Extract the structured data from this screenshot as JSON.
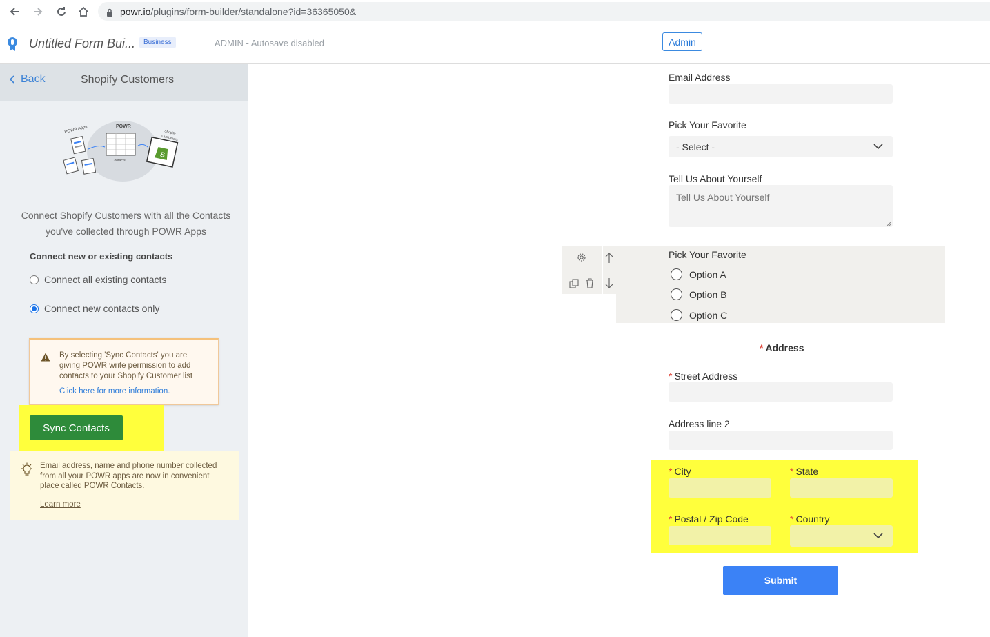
{
  "browser": {
    "url_host": "powr.io",
    "url_path": "/plugins/form-builder/standalone?id=36365050&"
  },
  "header": {
    "app_title": "Untitled Form Bui...",
    "plan_badge": "Business",
    "autosave_status": "ADMIN - Autosave disabled",
    "admin_button": "Admin"
  },
  "left_panel": {
    "back_label": "Back",
    "title": "Shopify Customers",
    "illustration": {
      "powr_apps": "POWR Apps",
      "powr": "POWR",
      "contacts": "Contacts",
      "shopify": "Shopify",
      "customers": "Customers"
    },
    "description_line1": "Connect Shopify Customers with all the Contacts",
    "description_line2": "you've collected through POWR Apps",
    "section_label": "Connect new or existing contacts",
    "options": [
      {
        "label": "Connect all existing contacts",
        "selected": false
      },
      {
        "label": "Connect new contacts only",
        "selected": true
      }
    ],
    "warning_text": "By selecting 'Sync Contacts' you are giving POWR write permission to add contacts to your Shopify Customer list",
    "warning_link": "Click here for more information.",
    "sync_button": "Sync Contacts",
    "info_text": "Email address, name and phone number collected from all your POWR apps are now in convenient place called POWR Contacts.",
    "info_link": "Learn more"
  },
  "form": {
    "email_label": "Email Address",
    "pick_label": "Pick Your Favorite",
    "pick_select_value": "- Select -",
    "about_label": "Tell Us About Yourself",
    "about_placeholder": "Tell Us About Yourself",
    "radio_label": "Pick Your Favorite",
    "radio_options": [
      "Option A",
      "Option B",
      "Option C"
    ],
    "address_heading": "Address",
    "street_label": "Street Address",
    "address2_label": "Address line 2",
    "city_label": "City",
    "state_label": "State",
    "zip_label": "Postal / Zip Code",
    "country_label": "Country",
    "submit_label": "Submit"
  },
  "colors": {
    "highlight": "#ffff3c",
    "sync_green": "#2e8b3a",
    "submit_blue": "#3b82f6",
    "required_red": "#e0473b"
  }
}
